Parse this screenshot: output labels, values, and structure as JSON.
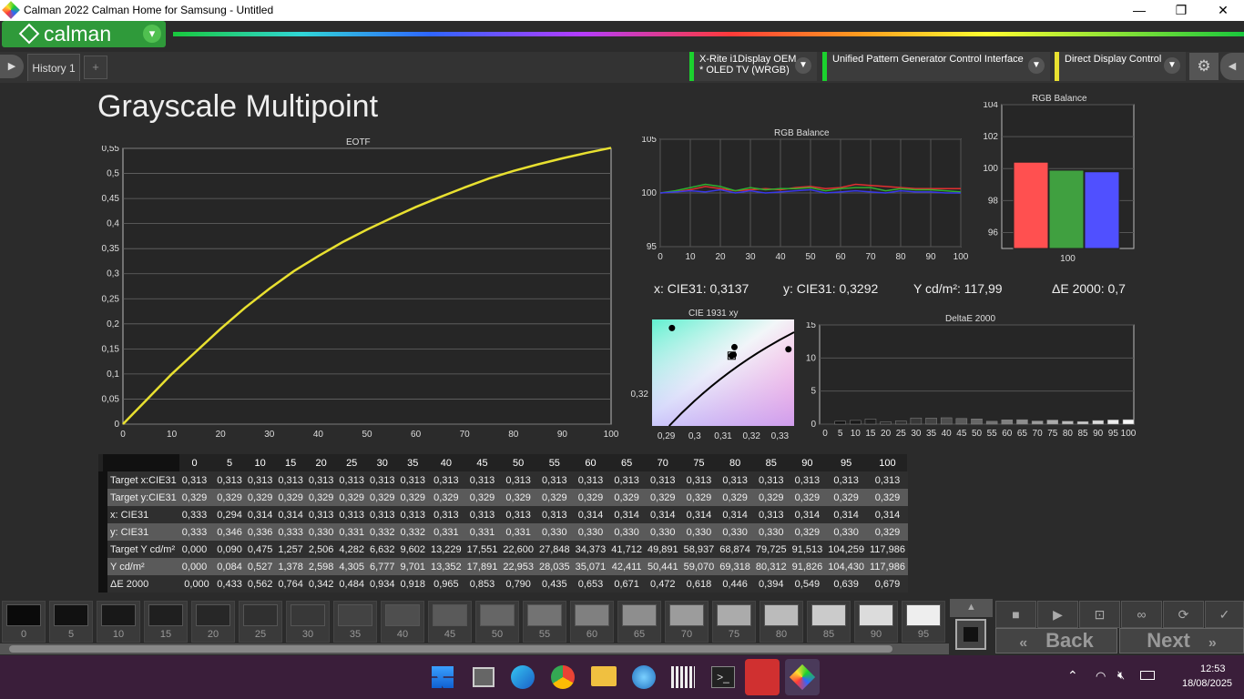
{
  "window": {
    "title": "Calman 2022 Calman Home for Samsung  - Untitled",
    "minimize": "—",
    "maximize": "❐",
    "close": "✕"
  },
  "app": {
    "logo": "calman",
    "logo_dropdown": "▾"
  },
  "tabs": [
    {
      "label": "History 1"
    }
  ],
  "add_tab": "+",
  "devices": [
    {
      "line1": "X-Rite i1Display OEM",
      "line2": "* OLED TV (WRGB)"
    },
    {
      "line1": "Unified Pattern Generator Control Interface",
      "line2": ""
    },
    {
      "line1": "Direct Display Control",
      "line2": ""
    }
  ],
  "page_title": "Grayscale Multipoint",
  "eotf": {
    "title": "EOTF",
    "chart_data": {
      "type": "line",
      "x": [
        0,
        5,
        10,
        15,
        20,
        25,
        30,
        35,
        40,
        45,
        50,
        55,
        60,
        65,
        70,
        75,
        80,
        85,
        90,
        95,
        100
      ],
      "y": [
        0,
        0.05,
        0.1,
        0.145,
        0.19,
        0.232,
        0.27,
        0.305,
        0.335,
        0.363,
        0.388,
        0.411,
        0.433,
        0.453,
        0.472,
        0.49,
        0.505,
        0.518,
        0.53,
        0.541,
        0.551
      ],
      "xlim": [
        0,
        100
      ],
      "ylim": [
        0,
        0.55
      ],
      "xticks": [
        "0",
        "10",
        "20",
        "30",
        "40",
        "50",
        "60",
        "70",
        "80",
        "90",
        "100"
      ],
      "yticks": [
        "0",
        "0,05",
        "0,1",
        "0,15",
        "0,2",
        "0,25",
        "0,3",
        "0,35",
        "0,4",
        "0,45",
        "0,5",
        "0,55"
      ],
      "color": "#e8e030"
    }
  },
  "rgb_line": {
    "title": "RGB Balance",
    "chart_data": {
      "type": "line",
      "x": [
        0,
        5,
        10,
        15,
        20,
        25,
        30,
        35,
        40,
        45,
        50,
        55,
        60,
        65,
        70,
        75,
        80,
        85,
        90,
        95,
        100
      ],
      "ylim": [
        95,
        105
      ],
      "yticks": [
        "95",
        "100",
        "105"
      ],
      "xticks": [
        "0",
        "10",
        "20",
        "30",
        "40",
        "50",
        "60",
        "70",
        "80",
        "90",
        "100"
      ],
      "series": [
        {
          "color": "#e03030",
          "values": [
            100,
            100.1,
            100.3,
            100.6,
            100.4,
            100.2,
            100.3,
            100.4,
            100.3,
            100.5,
            100.6,
            100.4,
            100.5,
            100.8,
            100.7,
            100.6,
            100.5,
            100.4,
            100.4,
            100.4,
            100.4
          ]
        },
        {
          "color": "#30b030",
          "values": [
            100,
            100.2,
            100.5,
            100.8,
            100.6,
            100.2,
            100.5,
            100.3,
            100.4,
            100.4,
            100.5,
            100.2,
            100.4,
            100.5,
            100.5,
            100.2,
            100.4,
            100.3,
            100.3,
            100.2,
            100.1
          ]
        },
        {
          "color": "#3838e8",
          "values": [
            100,
            100.1,
            100.2,
            100.1,
            100.3,
            100.0,
            100.2,
            100.0,
            100.1,
            100.2,
            100.3,
            100.0,
            100.1,
            100.2,
            100.1,
            100.0,
            100.2,
            100.1,
            100.1,
            100.0,
            100.0
          ]
        }
      ]
    }
  },
  "rgb_bar": {
    "title": "RGB Balance",
    "chart_data": {
      "type": "bar",
      "categories": [
        "100"
      ],
      "ylim": [
        95,
        104
      ],
      "yticks": [
        "96",
        "98",
        "100",
        "102",
        "104"
      ],
      "series": [
        {
          "color": "#ff5050",
          "values": [
            100.4
          ]
        },
        {
          "color": "#40a040",
          "values": [
            99.9
          ]
        },
        {
          "color": "#5050ff",
          "values": [
            99.8
          ]
        }
      ]
    }
  },
  "readouts": {
    "x": "x: CIE31: 0,3137",
    "y": "y: CIE31: 0,3292",
    "Y": "Y cd/m²: 117,99",
    "dE": "ΔE 2000: 0,7"
  },
  "cie": {
    "title": "CIE 1931 xy",
    "chart_data": {
      "type": "scatter",
      "xlim": [
        0.285,
        0.335
      ],
      "ylim": [
        0.3125,
        0.3375
      ],
      "xticks": [
        "0,29",
        "0,3",
        "0,31",
        "0,32",
        "0,33"
      ],
      "yticks": [
        "0,32",
        "0,34"
      ],
      "points": [
        {
          "x": 0.292,
          "y": 0.3355
        },
        {
          "x": 0.3137,
          "y": 0.3292
        },
        {
          "x": 0.314,
          "y": 0.331
        },
        {
          "x": 0.313,
          "y": 0.329
        },
        {
          "x": 0.333,
          "y": 0.3305
        }
      ]
    }
  },
  "deltae": {
    "title": "DeltaE 2000",
    "chart_data": {
      "type": "bar",
      "categories": [
        "0",
        "5",
        "10",
        "15",
        "20",
        "25",
        "30",
        "35",
        "40",
        "45",
        "50",
        "55",
        "60",
        "65",
        "70",
        "75",
        "80",
        "85",
        "90",
        "95",
        "100"
      ],
      "values": [
        0.0,
        0.433,
        0.562,
        0.764,
        0.342,
        0.484,
        0.934,
        0.918,
        0.965,
        0.853,
        0.79,
        0.435,
        0.653,
        0.671,
        0.472,
        0.618,
        0.446,
        0.394,
        0.549,
        0.639,
        0.679
      ],
      "ylim": [
        0,
        15
      ],
      "yticks": [
        "0",
        "5",
        "10",
        "15"
      ]
    }
  },
  "table": {
    "headers": [
      "",
      "0",
      "5",
      "10",
      "15",
      "20",
      "25",
      "30",
      "35",
      "40",
      "45",
      "50",
      "55",
      "60",
      "65",
      "70",
      "75",
      "80",
      "85",
      "90",
      "95",
      "100"
    ],
    "rows": [
      [
        "Target x:CIE31",
        "0,313",
        "0,313",
        "0,313",
        "0,313",
        "0,313",
        "0,313",
        "0,313",
        "0,313",
        "0,313",
        "0,313",
        "0,313",
        "0,313",
        "0,313",
        "0,313",
        "0,313",
        "0,313",
        "0,313",
        "0,313",
        "0,313",
        "0,313",
        "0,313"
      ],
      [
        "Target y:CIE31",
        "0,329",
        "0,329",
        "0,329",
        "0,329",
        "0,329",
        "0,329",
        "0,329",
        "0,329",
        "0,329",
        "0,329",
        "0,329",
        "0,329",
        "0,329",
        "0,329",
        "0,329",
        "0,329",
        "0,329",
        "0,329",
        "0,329",
        "0,329",
        "0,329"
      ],
      [
        "x: CIE31",
        "0,333",
        "0,294",
        "0,314",
        "0,314",
        "0,313",
        "0,313",
        "0,313",
        "0,313",
        "0,313",
        "0,313",
        "0,313",
        "0,313",
        "0,314",
        "0,314",
        "0,314",
        "0,314",
        "0,314",
        "0,313",
        "0,314",
        "0,314",
        "0,314"
      ],
      [
        "y: CIE31",
        "0,333",
        "0,346",
        "0,336",
        "0,333",
        "0,330",
        "0,331",
        "0,332",
        "0,332",
        "0,331",
        "0,331",
        "0,331",
        "0,330",
        "0,330",
        "0,330",
        "0,330",
        "0,330",
        "0,330",
        "0,330",
        "0,329",
        "0,330",
        "0,329"
      ],
      [
        "Target Y cd/m²",
        "0,000",
        "0,090",
        "0,475",
        "1,257",
        "2,506",
        "4,282",
        "6,632",
        "9,602",
        "13,229",
        "17,551",
        "22,600",
        "27,848",
        "34,373",
        "41,712",
        "49,891",
        "58,937",
        "68,874",
        "79,725",
        "91,513",
        "104,259",
        "117,986"
      ],
      [
        "Y cd/m²",
        "0,000",
        "0,084",
        "0,527",
        "1,378",
        "2,598",
        "4,305",
        "6,777",
        "9,701",
        "13,352",
        "17,891",
        "22,953",
        "28,035",
        "35,071",
        "42,411",
        "50,441",
        "59,070",
        "69,318",
        "80,312",
        "91,826",
        "104,430",
        "117,986"
      ],
      [
        "ΔE 2000",
        "0,000",
        "0,433",
        "0,562",
        "0,764",
        "0,342",
        "0,484",
        "0,934",
        "0,918",
        "0,965",
        "0,853",
        "0,790",
        "0,435",
        "0,653",
        "0,671",
        "0,472",
        "0,618",
        "0,446",
        "0,394",
        "0,549",
        "0,639",
        "0,679"
      ]
    ]
  },
  "swatches": [
    {
      "label": "0",
      "color": "#0a0a0a"
    },
    {
      "label": "5",
      "color": "#111"
    },
    {
      "label": "10",
      "color": "#181818"
    },
    {
      "label": "15",
      "color": "#1f1f1f"
    },
    {
      "label": "20",
      "color": "#272727"
    },
    {
      "label": "25",
      "color": "#303030"
    },
    {
      "label": "30",
      "color": "#383838"
    },
    {
      "label": "35",
      "color": "#434343"
    },
    {
      "label": "40",
      "color": "#4e4e4e"
    },
    {
      "label": "45",
      "color": "#5a5a5a"
    },
    {
      "label": "50",
      "color": "#666"
    },
    {
      "label": "55",
      "color": "#737373"
    },
    {
      "label": "60",
      "color": "#808080"
    },
    {
      "label": "65",
      "color": "#8e8e8e"
    },
    {
      "label": "70",
      "color": "#9c9c9c"
    },
    {
      "label": "75",
      "color": "#ababab"
    },
    {
      "label": "80",
      "color": "#bbb"
    },
    {
      "label": "85",
      "color": "#cbcbcb"
    },
    {
      "label": "90",
      "color": "#dcdcdc"
    },
    {
      "label": "95",
      "color": "#eee"
    }
  ],
  "nav": {
    "back": "Back",
    "next": "Next"
  },
  "clock": {
    "time": "12:53",
    "date": "18/08/2025"
  }
}
